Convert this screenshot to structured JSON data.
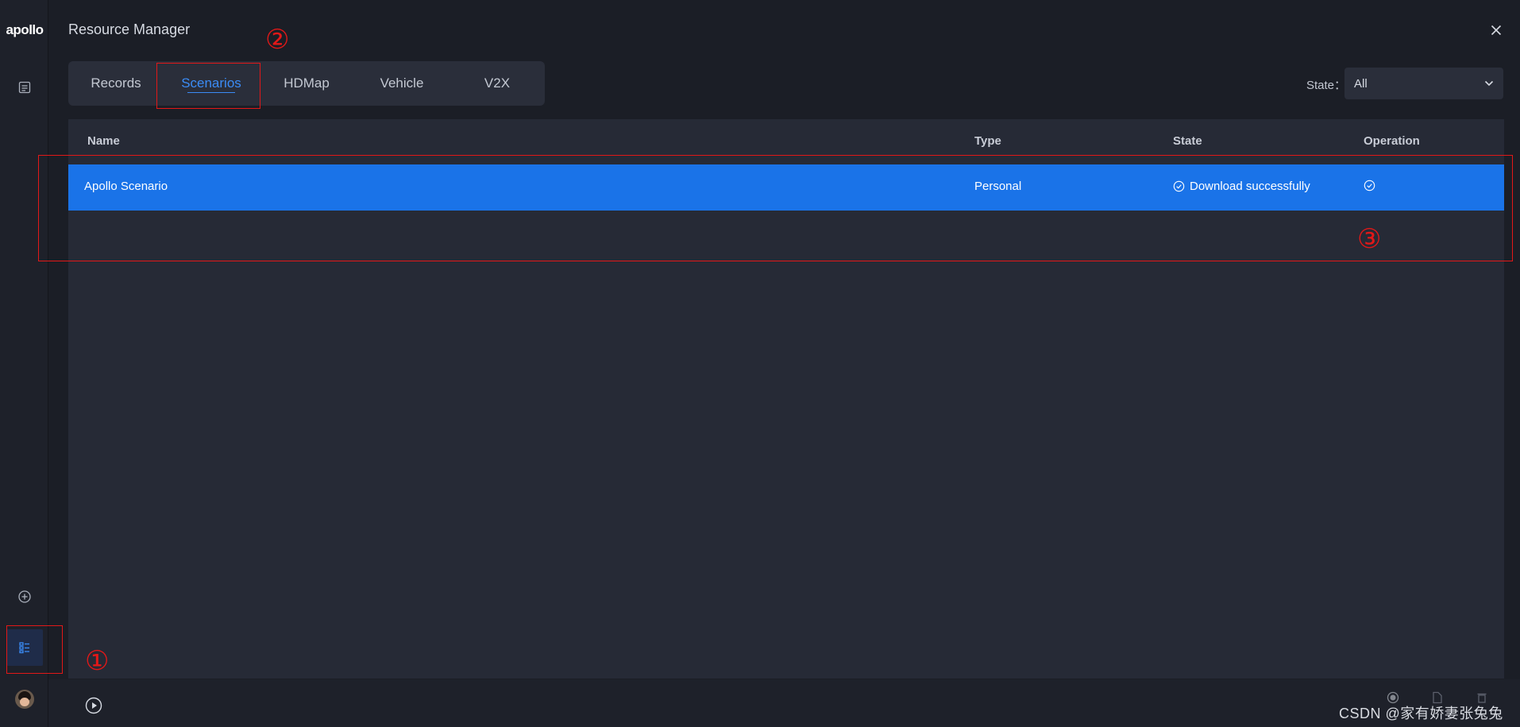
{
  "app": {
    "logo_text": "apollo",
    "window_title": "Resource Manager"
  },
  "rail": {
    "top_icon": "list-icon",
    "bottom_icons": [
      "add-circle-icon",
      "resource-manager-icon"
    ],
    "avatar": "user-avatar"
  },
  "tabs": [
    {
      "label": "Records",
      "active": false
    },
    {
      "label": "Scenarios",
      "active": true
    },
    {
      "label": "HDMap",
      "active": false
    },
    {
      "label": "Vehicle",
      "active": false
    },
    {
      "label": "V2X",
      "active": false
    }
  ],
  "filter": {
    "label": "State：",
    "value": "All"
  },
  "table": {
    "columns": [
      "Name",
      "Type",
      "State",
      "Operation"
    ],
    "rows": [
      {
        "name": "Apollo Scenario",
        "type": "Personal",
        "state": "Download successfully",
        "selected": true
      }
    ]
  },
  "annotations": [
    "①",
    "②",
    "③"
  ],
  "watermark": "CSDN @家有娇妻张兔兔",
  "colors": {
    "accent": "#3b8cf6",
    "selected_row": "#1a73e8",
    "annotation": "#e21818",
    "background": "#1b1e26",
    "panel": "#262a36"
  }
}
